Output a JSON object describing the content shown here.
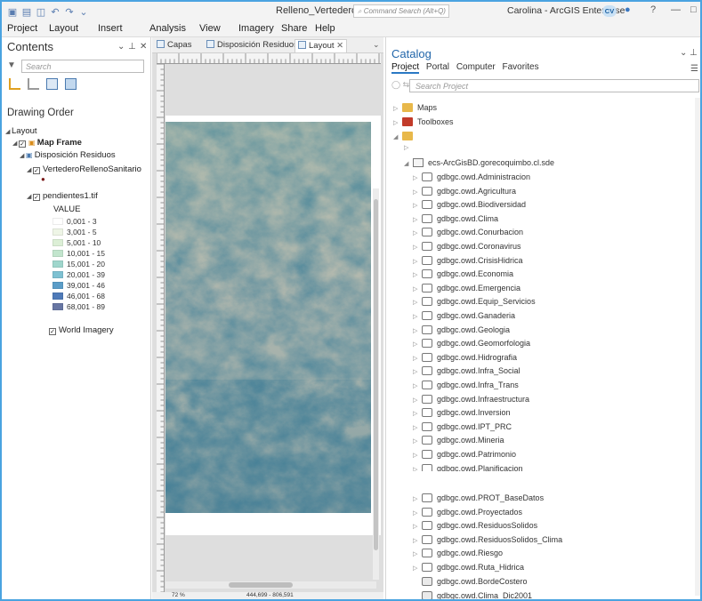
{
  "window": {
    "title": "Relleno_Vertederos",
    "command_search_placeholder": "Command Search (Alt+Q)",
    "user": "Carolina - ArcGIS Enterprise",
    "user_initials": "CV",
    "help": "?",
    "minimize": "—",
    "maximize": "□"
  },
  "menu": [
    "Project",
    "Layout",
    "Insert",
    "Analysis",
    "View",
    "Imagery",
    "Share",
    "Help"
  ],
  "contents": {
    "title": "Contents",
    "search_placeholder": "Search",
    "section": "Drawing Order",
    "layout": "Layout",
    "map_frame": "Map Frame",
    "map": "Disposición Residuos",
    "layer_points": "VertederoRellenoSanitario",
    "layer_raster": "pendientes1.tif",
    "value_label": "VALUE",
    "legend": [
      {
        "label": "0,001 - 3",
        "color": "#ffffff"
      },
      {
        "label": "3,001 - 5",
        "color": "#eef5e6"
      },
      {
        "label": "5,001 - 10",
        "color": "#dcefd6"
      },
      {
        "label": "10,001 - 15",
        "color": "#c2e5cd"
      },
      {
        "label": "15,001 - 20",
        "color": "#9fd6cc"
      },
      {
        "label": "20,001 - 39",
        "color": "#7ec1d2"
      },
      {
        "label": "39,001 - 46",
        "color": "#5b9dc8"
      },
      {
        "label": "46,001 - 68",
        "color": "#4f7ab8"
      },
      {
        "label": "68,001 - 89",
        "color": "#6776a3"
      }
    ],
    "basemap": "World Imagery"
  },
  "view": {
    "tabs": [
      "Capas",
      "Disposición Residuos",
      "Layout"
    ],
    "active_tab": "Layout",
    "scale": "72 %",
    "coords": "444,699 - 806,591"
  },
  "catalog": {
    "title": "Catalog",
    "tabs": [
      "Project",
      "Portal",
      "Computer",
      "Favorites"
    ],
    "active_tab": "Project",
    "search_placeholder": "Search Project",
    "items_top": [
      "Maps",
      "Toolboxes"
    ],
    "connection": "ecs-ArcGisBD.gorecoquimbo.cl.sde",
    "datasets": [
      "gdbgc.owd.Administracion",
      "gdbgc.owd.Agricultura",
      "gdbgc.owd.Biodiversidad",
      "gdbgc.owd.Clima",
      "gdbgc.owd.Conurbacion",
      "gdbgc.owd.Coronavirus",
      "gdbgc.owd.CrisisHidrica",
      "gdbgc.owd.Economia",
      "gdbgc.owd.Emergencia",
      "gdbgc.owd.Equip_Servicios",
      "gdbgc.owd.Ganaderia",
      "gdbgc.owd.Geologia",
      "gdbgc.owd.Geomorfologia",
      "gdbgc.owd.Hidrografia",
      "gdbgc.owd.Infra_Social",
      "gdbgc.owd.Infra_Trans",
      "gdbgc.owd.Infraestructura",
      "gdbgc.owd.Inversion",
      "gdbgc.owd.IPT_PRC",
      "gdbgc.owd.Mineria",
      "gdbgc.owd.Patrimonio",
      "gdbgc.owd.Planificacion"
    ],
    "datasets_2": [
      "gdbgc.owd.PROT_BaseDatos",
      "gdbgc.owd.Proyectados",
      "gdbgc.owd.ResiduosSolidos",
      "gdbgc.owd.ResiduosSolidos_Clima",
      "gdbgc.owd.Riesgo",
      "gdbgc.owd.Ruta_Hidrica"
    ],
    "tables": [
      "gdbgc.owd.BordeCostero",
      "gdbgc.owd.Clima_Dic2001"
    ]
  }
}
